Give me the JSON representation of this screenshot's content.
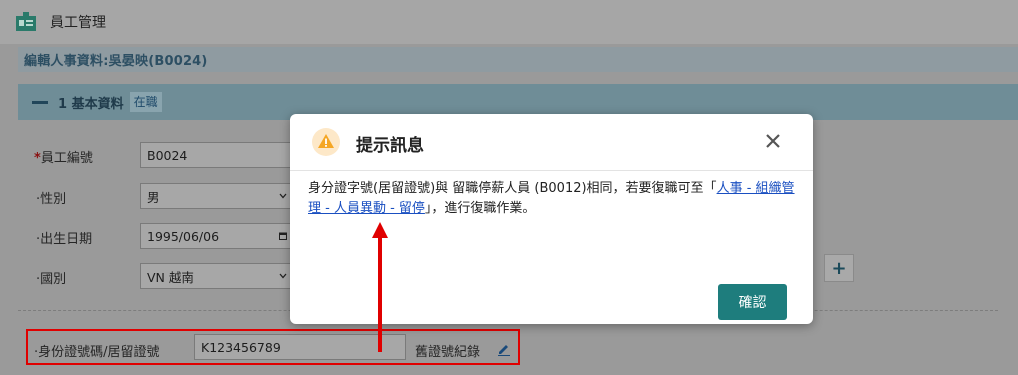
{
  "app": {
    "title": "員工管理"
  },
  "breadcrumb": {
    "text": "編輯人事資料:吳晏映(B0024)"
  },
  "section": {
    "title": "1 基本資料",
    "status": "在職"
  },
  "form": {
    "employee_id": {
      "label": "員工編號",
      "value": "B0024"
    },
    "gender": {
      "label": "·性別",
      "value": "男"
    },
    "birth_date": {
      "label": "·出生日期",
      "value": "1995/06/06"
    },
    "nationality": {
      "label": "·國別",
      "value": "VN 越南"
    },
    "id_number": {
      "label": "·身份證號碼/居留證號",
      "value": "K123456789"
    },
    "history_link": "舊證號紀錄"
  },
  "modal": {
    "title": "提示訊息",
    "message_before": "身分證字號(居留證號)與 留職停薪人員 (B0012)相同，若要復職可至「",
    "link_text": "人事 - 組織管理 - 人員異動 - 留停",
    "message_after": "」，進行復職作業。",
    "confirm_label": "確認"
  },
  "colors": {
    "accent": "#1e7d7d",
    "warning": "#f5a623",
    "highlight": "#e00000"
  }
}
